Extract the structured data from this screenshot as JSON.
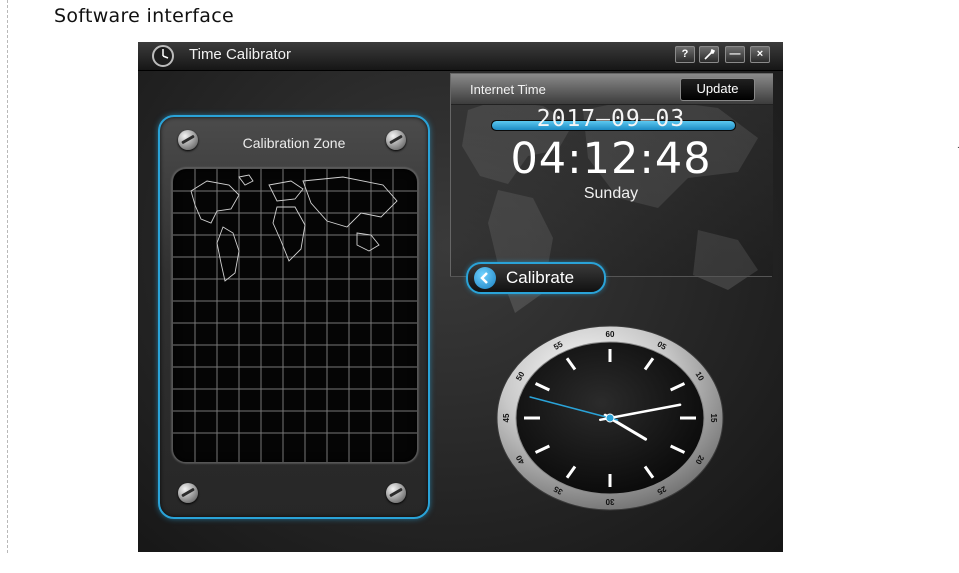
{
  "page": {
    "heading": "Software interface"
  },
  "window": {
    "title": "Time Calibrator",
    "buttons": {
      "help": "?",
      "minimize": "—",
      "close": "×"
    }
  },
  "calibration_zone": {
    "title": "Calibration Zone"
  },
  "internet_time": {
    "label": "Internet Time",
    "update_label": "Update",
    "sync_progress_percent": 100,
    "date": "2017—09—03",
    "time": "04:12:48",
    "day": "Sunday"
  },
  "calibrate": {
    "label": "Calibrate"
  },
  "analog_clock": {
    "hour": 4,
    "minute": 12,
    "second": 48,
    "second_marks": [
      "60",
      "05",
      "10",
      "15",
      "20",
      "25",
      "30",
      "35",
      "40",
      "45",
      "50",
      "55"
    ]
  },
  "colors": {
    "accent": "#2aa3d8",
    "background": "#262626",
    "title_bar": "#1e1e1e"
  },
  "icons": [
    "clock-icon",
    "help-icon",
    "settings-wrench-icon",
    "minimize-icon",
    "close-icon",
    "back-arrow-icon",
    "screw-icon"
  ]
}
